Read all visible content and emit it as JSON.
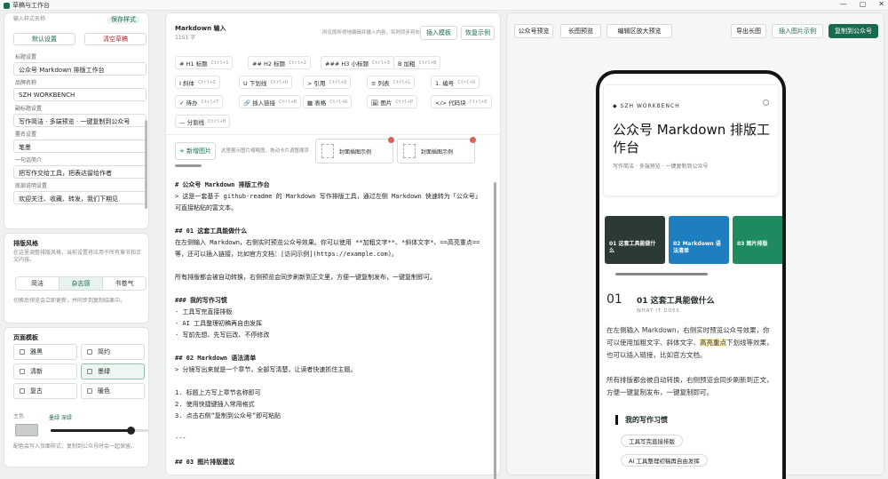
{
  "window": {
    "title": "草稿与工作台",
    "controls": [
      "—",
      "▢",
      "✕"
    ]
  },
  "left": {
    "search_placeholder": "输入样式名称",
    "save_style": "保存样式",
    "btn_reset": "默认设置",
    "btn_clear": "清空草稿",
    "fields": [
      {
        "label": "标题设置",
        "value": "公众号 Markdown 排版工作台"
      },
      {
        "label": "品牌名称",
        "value": "SZH WORKBENCH"
      },
      {
        "label": "副标题设置",
        "value": "写作简洁 · 多端预览 · 一键复制到公众号"
      },
      {
        "label": "署名设置",
        "value": "笔墨"
      },
      {
        "label": "一句话简介",
        "value": "把写作交给工具，把表达留给作者"
      },
      {
        "label": "底部说明设置",
        "value": "欢迎关注、收藏、转发，我们下期见"
      }
    ],
    "layout": {
      "title": "排版风格",
      "desc": "在这里调整排版风格，当前设置将应用于所有章节和正文内容。",
      "options": [
        "简洁",
        "杂志感",
        "书卷气"
      ],
      "selected": 1,
      "note": "切换后预览会立即更新，并同步到复制结果中。"
    },
    "template": {
      "title": "页面模板",
      "items": [
        "雅黑",
        "简约",
        "清新",
        "墨绿",
        "复古",
        "暖色"
      ],
      "selected": 3
    },
    "color": {
      "label": "主色",
      "value": "墨绿 深绿",
      "slider": 0.82
    },
    "footnote": "配色会写入页面样式，复制到公众号时会一起保留。"
  },
  "editor": {
    "title": "Markdown 输入",
    "count": "1151 字",
    "hint": "所见即所得地编辑并输入内容，实时同步到右侧预览",
    "insert_template": "插入模板",
    "restore_example": "恢复示例",
    "chips": [
      {
        "label": "# H1 标题",
        "key": "Ctrl+1"
      },
      {
        "label": "## H2 标题",
        "key": "Ctrl+2"
      },
      {
        "label": "### H3 小标题",
        "key": "Ctrl+3"
      },
      {
        "label": "B 加粗",
        "key": "Ctrl+B"
      },
      {
        "label": "I 斜体",
        "key": "Ctrl+I"
      },
      {
        "label": "U 下划线",
        "key": "Ctrl+U"
      },
      {
        "label": "> 引用",
        "key": "Ctrl+Q"
      },
      {
        "label": "≡ 列表",
        "key": "Ctrl+L"
      },
      {
        "label": "1. 编号",
        "key": "Ctrl+O"
      },
      {
        "label": "✓ 待办",
        "key": "Ctrl+T"
      },
      {
        "label": "🔗 插入链接",
        "key": "Ctrl+K"
      },
      {
        "label": "▦ 表格",
        "key": "Ctrl+G"
      },
      {
        "label": "🖼 图片",
        "key": "Ctrl+P"
      },
      {
        "label": "</> 代码块",
        "key": "Ctrl+E"
      },
      {
        "label": "— 分割线",
        "key": "Ctrl+H"
      }
    ],
    "new_image": "+ 新增图片",
    "image_hint": "这里展示图片缩略图，拖动卡片调整顺序",
    "images": [
      "封面插图示例",
      "封面插图示例"
    ],
    "lines": [
      "# 公众号 Markdown 排版工作台",
      "> 这是一套基于 github-readme 的 Markdown 写作排版工具，通过左侧 Markdown 快速转为「公众号」",
      "  可直接粘贴的富文本。",
      "",
      "## 01 这套工具能做什么",
      "在左侧输入 Markdown，右侧实时预览公众号效果。你可以使用 **加粗文字**、*斜体文字*、==高亮重点==",
      "等，还可以插入链接，比如官方文档：[访问示例](https://example.com)。",
      "",
      "所有排版都会被自动转换，右侧预览会同步刷新到正文里，方便一键复制发布，一键复制即可。",
      "",
      "### 我的写作习惯",
      "- 工具写完直接排版",
      "- AI 工具整理初稿再自由发挥",
      "- 写前先想、先写后改、不停修改",
      "",
      "## 02 Markdown 语法清单",
      "> 分镜写出来就是一个章节，全部写清楚，让读者快速抓住主题。",
      "",
      "1. 标题上方写上章节名称即可",
      "2. 使用快捷键插入常用格式",
      "3. 点击右侧“复制到公众号”即可粘贴",
      "",
      "---",
      "",
      "## 03 图片排版建议"
    ]
  },
  "preview": {
    "tabs": [
      "公众号预览",
      "长图预览",
      "编辑区放大预览"
    ],
    "actions": [
      "导出长图",
      "插入图片示例",
      "复制到公众号"
    ],
    "brand": "◆ SZH WORKBENCH",
    "title": "公众号 Markdown 排版工作台",
    "subtitle": "写作简洁 · 多端预览 · 一键复制到公众号",
    "cards": [
      {
        "text": "01 这套工具能做什么",
        "color": "#2b3a36"
      },
      {
        "text": "02 Markdown 语法清单",
        "color": "#1d7fc0"
      },
      {
        "text": "03 图片排版",
        "color": "#1f8a5f"
      }
    ],
    "section_num": "01",
    "section_title": "01 这套工具能做什么",
    "section_sub": "WHAT IT DOES",
    "para1_a": "在左侧输入 Markdown，右侧实时预览公众号效果，你可以使用加粗文字、斜体文字、",
    "para1_hl": "高亮重点",
    "para1_b": "下划线等效果，也可以插入链接，比如官方文档。",
    "para2": "所有排版都会被自动转换，右侧预览会同步刷新到正文，方便一键复制发布，一键复制即可。",
    "habit_title": "我的写作习惯",
    "habits": [
      "工具写完直接排版",
      "AI 工具整理初稿再自由发挥"
    ]
  }
}
